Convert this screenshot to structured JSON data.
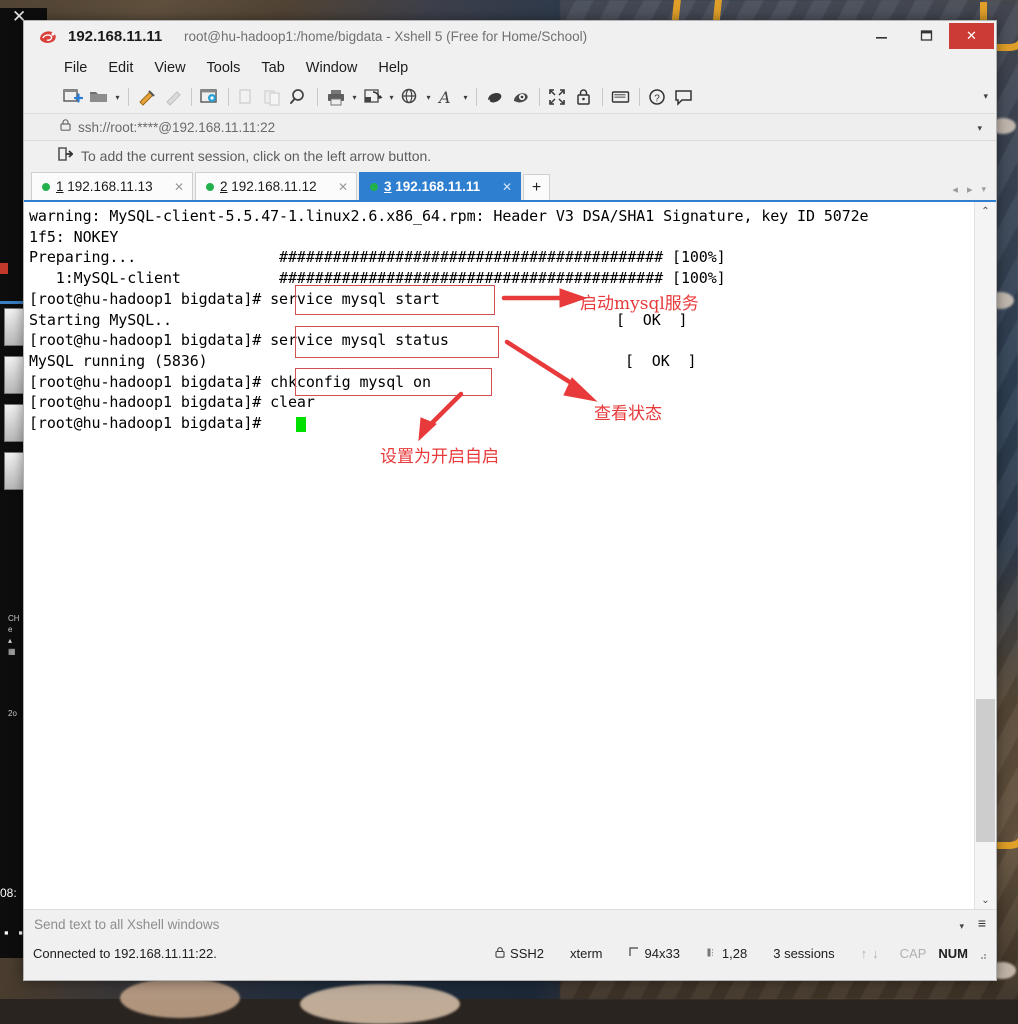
{
  "window": {
    "app_icon": "xshell-icon",
    "title": "192.168.11.11",
    "subtitle": "root@hu-hadoop1:/home/bigdata - Xshell 5 (Free for Home/School)",
    "minimize_label": "—",
    "maximize_label": "▭",
    "close_label": "✕"
  },
  "menu": {
    "items": [
      "File",
      "Edit",
      "View",
      "Tools",
      "Tab",
      "Window",
      "Help"
    ]
  },
  "toolbar": {
    "items": [
      {
        "name": "new-session-icon",
        "label": "New Session"
      },
      {
        "name": "open-folder-icon",
        "label": "Open"
      },
      {
        "name": "open-folder-caret",
        "label": "▾"
      },
      {
        "name": "connect-icon",
        "label": "Connect"
      },
      {
        "name": "disconnect-icon",
        "label": "Disconnect"
      },
      {
        "name": "session-properties-icon",
        "label": "Properties"
      },
      {
        "name": "copy-icon",
        "label": "Copy"
      },
      {
        "name": "paste-icon",
        "label": "Paste"
      },
      {
        "name": "find-icon",
        "label": "Find"
      },
      {
        "name": "print-icon",
        "label": "Print"
      },
      {
        "name": "print-caret",
        "label": "▾"
      },
      {
        "name": "transfer-file-icon",
        "label": "File Transfer"
      },
      {
        "name": "transfer-caret",
        "label": "▾"
      },
      {
        "name": "globe-icon",
        "label": "Open Web"
      },
      {
        "name": "globe-caret",
        "label": "▾"
      },
      {
        "name": "font-icon",
        "label": "Font"
      },
      {
        "name": "font-caret",
        "label": "▾"
      },
      {
        "name": "shell-icon",
        "label": "Shell"
      },
      {
        "name": "highlight-icon",
        "label": "Highlight"
      },
      {
        "name": "fullscreen-icon",
        "label": "Full Screen"
      },
      {
        "name": "lock-icon",
        "label": "Lock"
      },
      {
        "name": "keyboard-icon",
        "label": "Keyboard"
      },
      {
        "name": "help-icon",
        "label": "Help"
      },
      {
        "name": "feedback-icon",
        "label": "Feedback"
      }
    ],
    "overflow_label": "▾"
  },
  "address_bar": {
    "icon": "lock-icon",
    "value": "ssh://root:****@192.168.11.11:22",
    "dropdown_label": "▾"
  },
  "hint_bar": {
    "icon": "add-session-icon",
    "text": "To add the current session, click on the left arrow button."
  },
  "tabs": {
    "items": [
      {
        "index": "1",
        "host": "192.168.11.13",
        "active": false,
        "close_label": "✕",
        "status": "connected"
      },
      {
        "index": "2",
        "host": "192.168.11.12",
        "active": false,
        "close_label": "✕",
        "status": "connected"
      },
      {
        "index": "3",
        "host": "192.168.11.11",
        "active": true,
        "close_label": "✕",
        "status": "connected"
      }
    ],
    "new_tab_label": "+",
    "prev_label": "◂",
    "next_label": "▸",
    "list_label": "▾"
  },
  "terminal": {
    "lines": [
      "warning: MySQL-client-5.5.47-1.linux2.6.x86_64.rpm: Header V3 DSA/SHA1 Signature, key ID 5072e",
      "1f5: NOKEY",
      "Preparing...                ########################################### [100%]",
      "   1:MySQL-client           ########################################### [100%]",
      "[root@hu-hadoop1 bigdata]# service mysql start",
      "Starting MySQL..",
      "[root@hu-hadoop1 bigdata]# service mysql status",
      "MySQL running (5836)",
      "[root@hu-hadoop1 bigdata]# chkconfig mysql on",
      "[root@hu-hadoop1 bigdata]# clear",
      "[root@hu-hadoop1 bigdata]# "
    ],
    "ok_markers": [
      {
        "text": "[  OK  ]",
        "line": 4
      },
      {
        "text": "[  OK  ]",
        "line": 6
      }
    ],
    "ok_color": "#00a000",
    "cursor_color": "#00e000",
    "boxed_commands": [
      "service mysql start",
      "service mysql status",
      "chkconfig mysql on"
    ],
    "annotations": [
      {
        "text": "启动mysql服务",
        "meaning": "start mysql service"
      },
      {
        "text": "查看状态",
        "meaning": "check status"
      },
      {
        "text": "设置为开启自启",
        "meaning": "set to auto-start on boot"
      }
    ],
    "annotation_color": "#e83a3a",
    "scroll": {
      "up_label": "⌃",
      "down_label": "⌄"
    }
  },
  "send_bar": {
    "placeholder": "Send text to all Xshell windows",
    "dropdown_label": "▾",
    "menu_label": "≡"
  },
  "status_bar": {
    "connection": "Connected to 192.168.11.11:22.",
    "protocol": "SSH2",
    "terminal_type": "xterm",
    "size": "94x33",
    "cursor_position": "1,28",
    "sessions": "3 sessions",
    "up_label": "↑",
    "down_label": "↓",
    "cap": "CAP",
    "num": "NUM"
  },
  "behind_window": {
    "close_label": "✕",
    "clock": "08:",
    "dots": "▪ ▪"
  }
}
